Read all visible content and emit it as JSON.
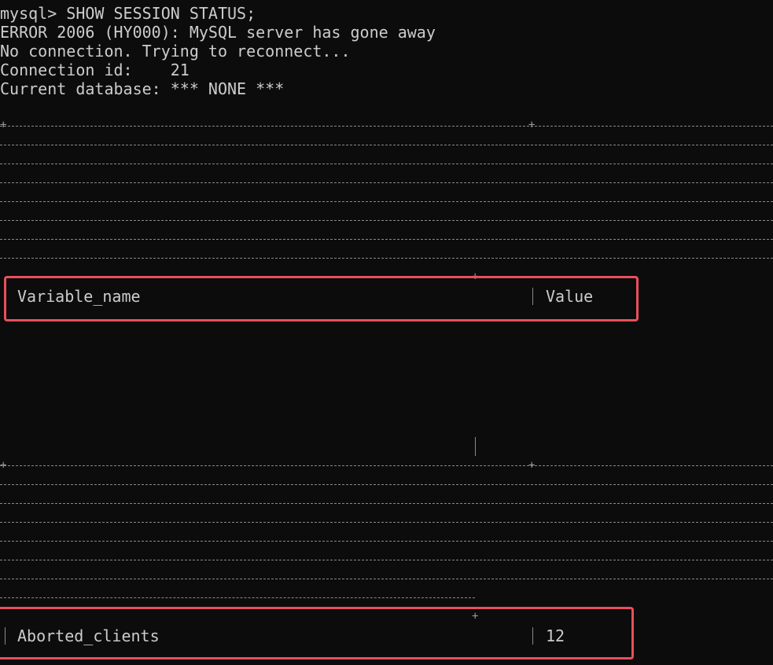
{
  "terminal": {
    "lines": [
      "mysql> SHOW SESSION STATUS;",
      "ERROR 2006 (HY000): MySQL server has gone away",
      "No connection. Trying to reconnect...",
      "Connection id:    21",
      "Current database: *** NONE ***"
    ]
  },
  "table": {
    "header": {
      "variable_name": "Variable_name",
      "value": "Value"
    },
    "rows": [
      {
        "variable_name": "Aborted_clients",
        "value": "12"
      }
    ]
  },
  "colors": {
    "background": "#0c0c0c",
    "text": "#cccccc",
    "highlight": "#e8505b",
    "border_dash": "#8a8a8a"
  }
}
